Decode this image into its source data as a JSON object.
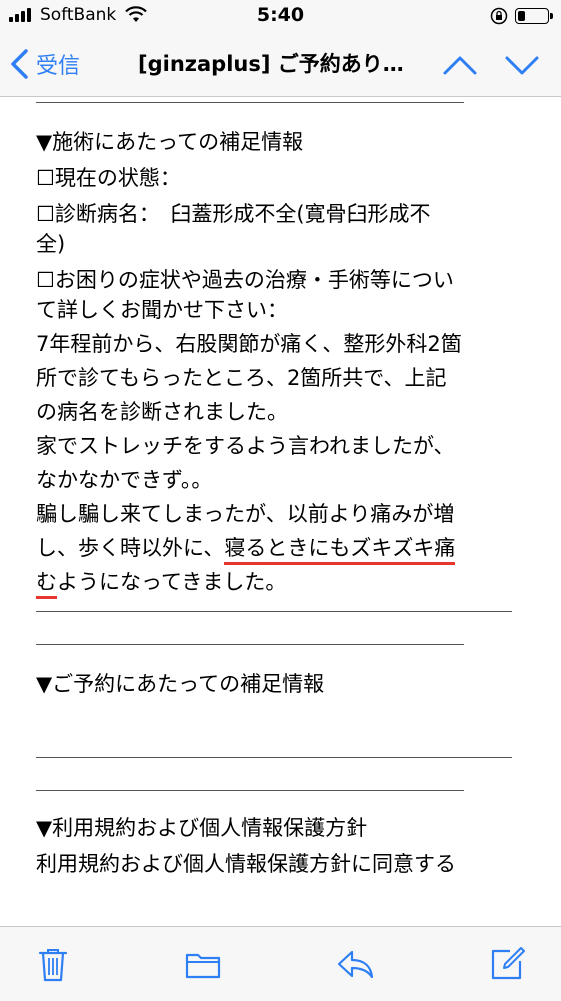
{
  "status_bar": {
    "carrier": "SoftBank",
    "time": "5:40",
    "battery_level": 0.25
  },
  "nav": {
    "back_label": "受信",
    "title": "[ginzaplus] ご予約あり…"
  },
  "email": {
    "section1_heading": "▼施術にあたっての補足情報",
    "current_state": "☐現在の状態：",
    "diagnosis_line1": "☐診断病名：　臼蓋形成不全(寛骨臼形成不",
    "diagnosis_line2": "全)",
    "symptoms_line1": "☐お困りの症状や過去の治療・手術等につい",
    "symptoms_line2": "て詳しくお聞かせ下さい：",
    "body_line1": "7年程前から、右股関節が痛く、整形外科2箇",
    "body_line2": "所で診てもらったところ、2箇所共で、上記",
    "body_line3": "の病名を診断されました。",
    "body_line4": "家でストレッチをするよう言われましたが、",
    "body_line5": "なかなかできず。。",
    "body_line6": "騙し騙し来てしまったが、以前より痛みが増",
    "body_line7_pre": "し、歩く時以外に、",
    "body_line7_highlight": "寝るときにもズキズキ痛",
    "body_line8_highlight": "む",
    "body_line8_post": "ようになってきました。",
    "section2_heading": "▼ご予約にあたっての補足情報",
    "section3_heading": "▼利用規約および個人情報保護方針",
    "terms_agree": "利用規約および個人情報保護方針に同意する"
  },
  "toolbar": {
    "icons": [
      "trash-icon",
      "folder-icon",
      "reply-icon",
      "compose-icon"
    ]
  },
  "colors": {
    "accent": "#2f7ff4",
    "underline": "#e6362e"
  }
}
